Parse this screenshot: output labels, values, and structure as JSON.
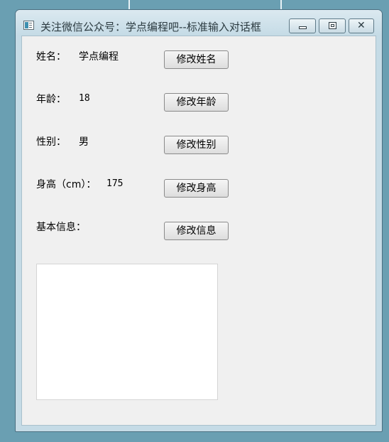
{
  "window": {
    "title": "关注微信公众号：学点编程吧--标准输入对话框",
    "close_glyph": "✕"
  },
  "form": {
    "name": {
      "label": "姓名：",
      "value": "学点编程",
      "button": "修改姓名"
    },
    "age": {
      "label": "年龄：",
      "value": "18",
      "button": "修改年龄"
    },
    "gender": {
      "label": "性别：",
      "value": "男",
      "button": "修改性别"
    },
    "height": {
      "label": "身高（cm）：",
      "value": "175",
      "button": "修改身高"
    },
    "info": {
      "label": "基本信息：",
      "value": "",
      "button": "修改信息"
    }
  }
}
